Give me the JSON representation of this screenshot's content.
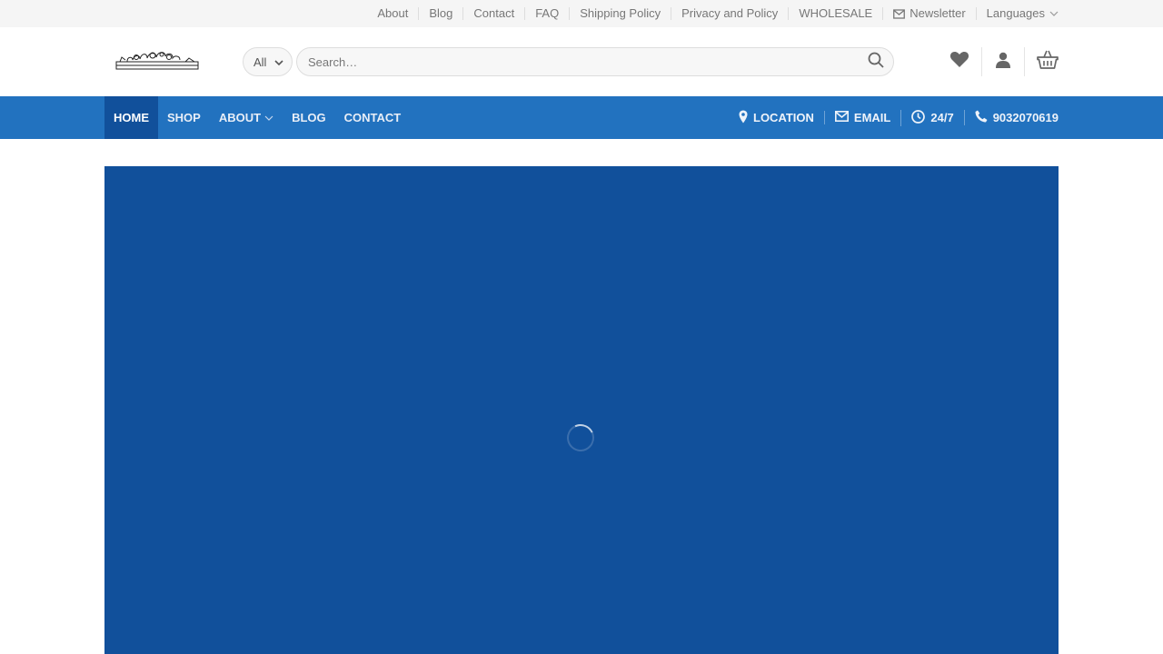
{
  "topbar": {
    "links": [
      "About",
      "Blog",
      "Contact",
      "FAQ",
      "Shipping Policy",
      "Privacy and Policy",
      "WHOLESALE"
    ],
    "newsletter": "Newsletter",
    "languages": "Languages"
  },
  "search": {
    "category": "All",
    "placeholder": "Search…"
  },
  "nav": {
    "items": [
      "HOME",
      "SHOP",
      "ABOUT",
      "BLOG",
      "CONTACT"
    ],
    "location": "LOCATION",
    "email": "EMAIL",
    "hours": "24/7",
    "phone": "9032070619"
  },
  "colors": {
    "nav_bg": "#2272bf",
    "nav_active": "#11509b",
    "hero_bg": "#11509b"
  },
  "icons": [
    "envelope-icon",
    "chevron-down-icon",
    "search-icon",
    "heart-icon",
    "user-icon",
    "basket-icon",
    "map-pin-icon",
    "clock-icon",
    "phone-icon",
    "loading-spinner"
  ]
}
